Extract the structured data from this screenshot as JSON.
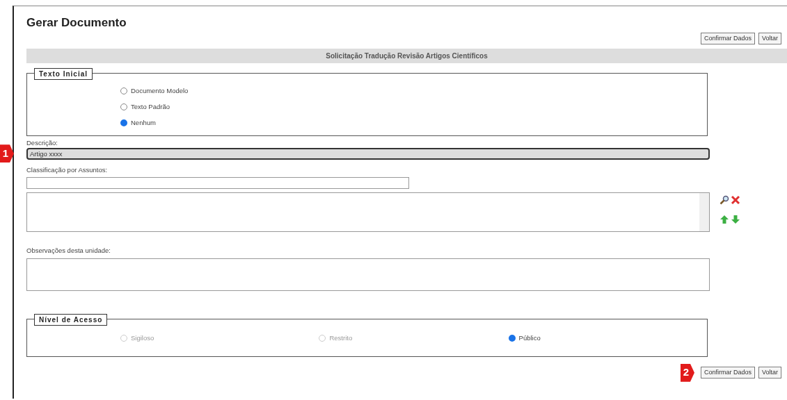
{
  "page_title": "Gerar Documento",
  "top_buttons": [
    "Confirmar Dados",
    "Voltar"
  ],
  "section_title": "Solicitação Tradução Revisão Artigos Científicos",
  "texto_inicial": {
    "legend": "Texto Inicial",
    "options": [
      {
        "label": "Documento Modelo",
        "selected": false
      },
      {
        "label": "Texto Padrão",
        "selected": false
      },
      {
        "label": "Nenhum",
        "selected": true
      }
    ]
  },
  "descricao": {
    "label": "Descrição:",
    "value": "Artigo xxxx",
    "marker": "1"
  },
  "classificacao": {
    "label": "Classificação por Assuntos:"
  },
  "observacoes": {
    "label": "Observações desta unidade:"
  },
  "nivel_acesso": {
    "legend": "Nível de Acesso",
    "options": [
      {
        "label": "Sigiloso",
        "selected": false,
        "disabled": true
      },
      {
        "label": "Restrito",
        "selected": false,
        "disabled": true
      },
      {
        "label": "Público",
        "selected": true,
        "disabled": false
      }
    ]
  },
  "bottom_buttons": [
    "Confirmar Dados",
    "Voltar"
  ],
  "bottom_marker": "2"
}
